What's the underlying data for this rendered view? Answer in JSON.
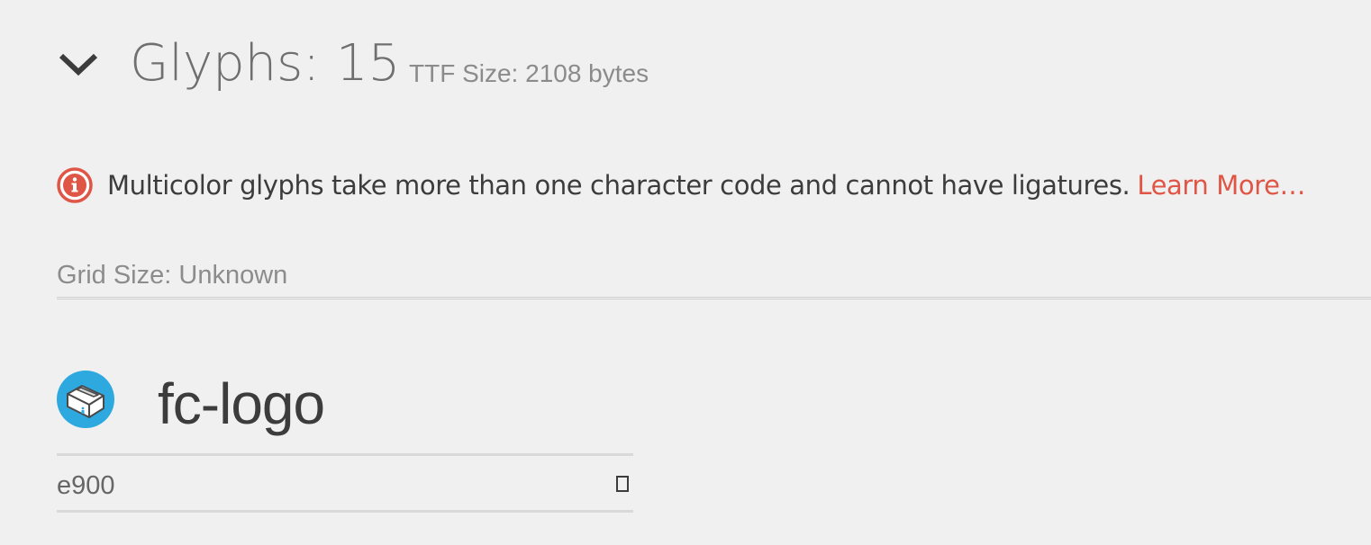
{
  "header": {
    "title": "Glyphs: 15",
    "ttf_size": "TTF Size: 2108 bytes",
    "toggle_icon": "chevron-down-icon"
  },
  "notice": {
    "icon": "info-icon",
    "message": "Multicolor glyphs take more than one character code and cannot have ligatures.",
    "link": "Learn More…",
    "icon_color": "#e05646",
    "link_color": "#e05646"
  },
  "grid": {
    "label": "Grid Size: Unknown"
  },
  "glyphs": [
    {
      "name": "fc-logo",
      "code": "e900",
      "icon": "fc-logo-icon",
      "icon_color": "#2ea9e0",
      "char_icon": "square-glyph-icon"
    }
  ]
}
